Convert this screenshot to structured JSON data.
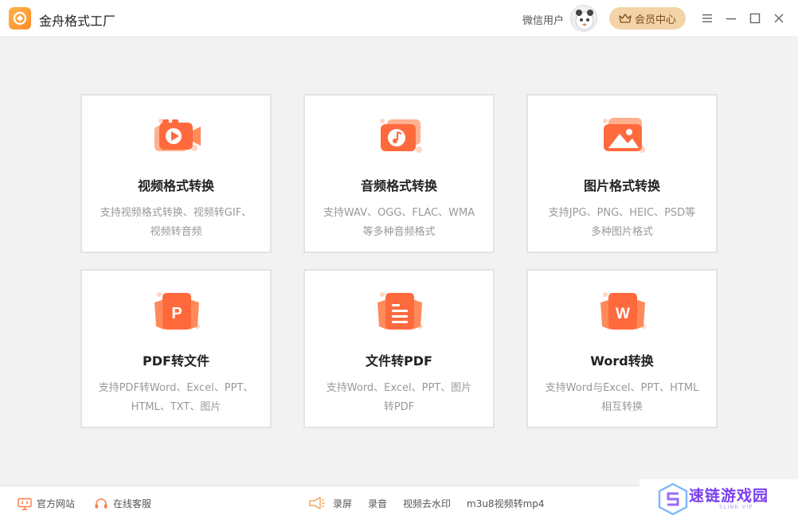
{
  "app": {
    "title": "金舟格式工厂"
  },
  "header": {
    "user_name": "微信用户",
    "vip_label": "会员中心"
  },
  "cards": [
    {
      "title": "视频格式转换",
      "desc_line1": "支持视频格式转换、视频转GIF、",
      "desc_line2": "视频转音频",
      "icon": "video-convert-icon"
    },
    {
      "title": "音频格式转换",
      "desc_line1": "支持WAV、OGG、FLAC、WMA",
      "desc_line2": "等多种音频格式",
      "icon": "audio-convert-icon"
    },
    {
      "title": "图片格式转换",
      "desc_line1": "支持JPG、PNG、HEIC、PSD等",
      "desc_line2": "多种图片格式",
      "icon": "image-convert-icon"
    },
    {
      "title": "PDF转文件",
      "desc_line1": "支持PDF转Word、Excel、PPT、",
      "desc_line2": "HTML、TXT、图片",
      "icon": "pdf-convert-icon",
      "glyph": "P"
    },
    {
      "title": "文件转PDF",
      "desc_line1": "支持Word、Excel、PPT、图片",
      "desc_line2": "转PDF",
      "icon": "file-to-pdf-icon"
    },
    {
      "title": "Word转换",
      "desc_line1": "支持Word与Excel、PPT、HTML",
      "desc_line2": "相互转换",
      "icon": "word-convert-icon",
      "glyph": "W"
    }
  ],
  "footer": {
    "website": "官方网站",
    "support": "在线客服",
    "record_screen": "录屏",
    "record_audio": "录音",
    "remove_watermark": "视频去水印",
    "m3u8": "m3u8视频转mp4"
  },
  "watermark": {
    "text": "速链游戏园",
    "sub": "SLINK VIP"
  },
  "colors": {
    "accent": "#ff6a3d",
    "accent_light": "#ffb08f",
    "vip_bg": "#f3d3a8",
    "desc_gray": "#999999"
  }
}
